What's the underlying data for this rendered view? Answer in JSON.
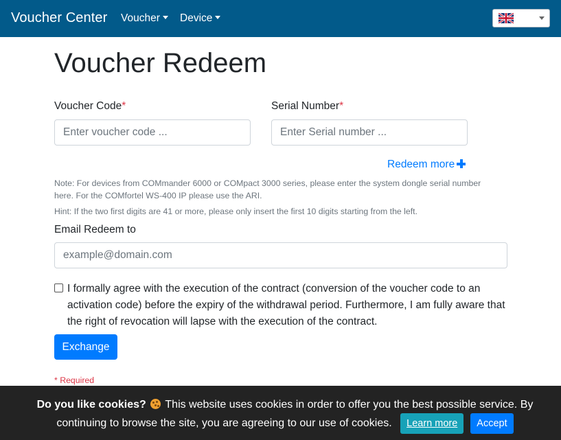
{
  "navbar": {
    "brand": "Voucher Center",
    "menu": [
      {
        "label": "Voucher"
      },
      {
        "label": "Device"
      }
    ],
    "language": {
      "flag_icon": "uk-flag-icon",
      "selected": ""
    }
  },
  "page": {
    "title": "Voucher Redeem"
  },
  "form": {
    "voucher_code": {
      "label": "Voucher Code",
      "required_mark": "*",
      "placeholder": "Enter voucher code ...",
      "value": ""
    },
    "serial_number": {
      "label": "Serial Number",
      "required_mark": "*",
      "placeholder": "Enter Serial number ...",
      "value": ""
    },
    "redeem_more": "Redeem more",
    "note": "Note: For devices from COMmander 6000 or COMpact 3000 series, please enter the system dongle serial number here. For the COMfortel WS-400 IP please use the ARI.",
    "hint": "Hint: If the two first digits are 41 or more, please only insert the first 10 digits starting from the left.",
    "email": {
      "label": "Email Redeem to",
      "placeholder": "example@domain.com",
      "value": ""
    },
    "agreement": {
      "checked": false,
      "text": "I formally agree with the execution of the contract (conversion of the voucher code to an activation code) before the expiry of the withdrawal period. Furthermore, I am fully aware that the right of revocation will lapse with the execution of the contract."
    },
    "submit_label": "Exchange",
    "required_note": "* Required"
  },
  "cookie_banner": {
    "question": "Do you like cookies?",
    "message": "This website uses cookies in order to offer you the best possible service. By continuing to browse the site, you are agreeing to our use of cookies.",
    "learn_more": "Learn more",
    "accept": "Accept",
    "icon": "cookie-icon"
  },
  "colors": {
    "navbar": "#025a8a",
    "primary": "#007bff",
    "info": "#17a2b8",
    "danger": "#dc3545",
    "cookie_bar": "#232323"
  }
}
